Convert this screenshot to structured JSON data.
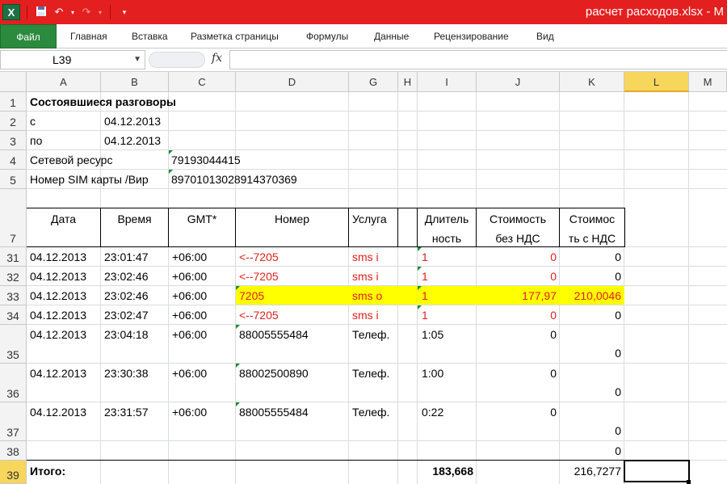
{
  "app": {
    "icon_letter": "X",
    "window_title": "расчет расходов.xlsx  -  M",
    "qat": {
      "save_icon": "save-icon",
      "undo_icon": "undo-icon",
      "redo_icon": "redo-icon"
    }
  },
  "ribbon": {
    "file_tab": "Файл",
    "tabs": [
      "Главная",
      "Вставка",
      "Разметка страницы",
      "Формулы",
      "Данные",
      "Рецензирование",
      "Вид"
    ]
  },
  "formula_bar": {
    "name_box": "L39",
    "fx": "fx",
    "value": ""
  },
  "columns": [
    "A",
    "B",
    "C",
    "D",
    "G",
    "H",
    "I",
    "J",
    "K",
    "L",
    "M"
  ],
  "rows": [
    "1",
    "2",
    "3",
    "4",
    "5",
    "7",
    "31",
    "32",
    "33",
    "34",
    "35",
    "36",
    "37",
    "38",
    "39"
  ],
  "sheet": {
    "r1": {
      "a": "Состоявшиеся разговоры"
    },
    "r2": {
      "a": "с",
      "b": "04.12.2013"
    },
    "r3": {
      "a": "по",
      "b": "04.12.2013"
    },
    "r4": {
      "a": "Сетевой ресурс",
      "c": "79193044415"
    },
    "r5": {
      "a": "Номер SIM карты /Вир",
      "c": "89701013028914370369"
    },
    "header": {
      "date": "Дата",
      "time": "Время",
      "gmt": "GMT*",
      "number": "Номер",
      "service": "Услуга",
      "duration_1": "Длитель",
      "duration_2": "ность",
      "cost_novat_1": "Стоимость",
      "cost_novat_2": "без НДС",
      "cost_vat_1": "Стоимос",
      "cost_vat_2": "ть с НДС"
    },
    "data_rows": [
      {
        "date": "04.12.2013",
        "time": "23:01:47",
        "gmt": "+06:00",
        "number": "<--7205",
        "service": "sms i",
        "duration": "1",
        "cost_novat": "0",
        "cost_vat": "0"
      },
      {
        "date": "04.12.2013",
        "time": "23:02:46",
        "gmt": "+06:00",
        "number": "<--7205",
        "service": "sms i",
        "duration": "1",
        "cost_novat": "0",
        "cost_vat": "0"
      },
      {
        "date": "04.12.2013",
        "time": "23:02:46",
        "gmt": "+06:00",
        "number": "7205",
        "service": "sms o",
        "duration": "1",
        "cost_novat": "177,97",
        "cost_vat": "210,0046"
      },
      {
        "date": "04.12.2013",
        "time": "23:02:47",
        "gmt": "+06:00",
        "number": "<--7205",
        "service": "sms i",
        "duration": "1",
        "cost_novat": "0",
        "cost_vat": "0"
      },
      {
        "date": "04.12.2013",
        "time": "23:04:18",
        "gmt": "+06:00",
        "number": "88005555484",
        "service": "Телеф.",
        "duration": "1:05",
        "cost_novat": "0",
        "cost_vat": "0"
      },
      {
        "date": "04.12.2013",
        "time": "23:30:38",
        "gmt": "+06:00",
        "number": "88002500890",
        "service": "Телеф.",
        "duration": "1:00",
        "cost_novat": "0",
        "cost_vat": "0"
      },
      {
        "date": "04.12.2013",
        "time": "23:31:57",
        "gmt": "+06:00",
        "number": "88005555484",
        "service": "Телеф.",
        "duration": "0:22",
        "cost_novat": "0",
        "cost_vat": "0"
      }
    ],
    "r38": {
      "k": "0"
    },
    "r39": {
      "a": "Итого:",
      "i": "183,668",
      "k": "216,7277"
    }
  },
  "colors": {
    "title_bar": "#e41f1f",
    "file_tab": "#2b8a3e",
    "highlight": "#ffff00",
    "text_red": "#e0201c",
    "active_header": "#f7d65c"
  }
}
